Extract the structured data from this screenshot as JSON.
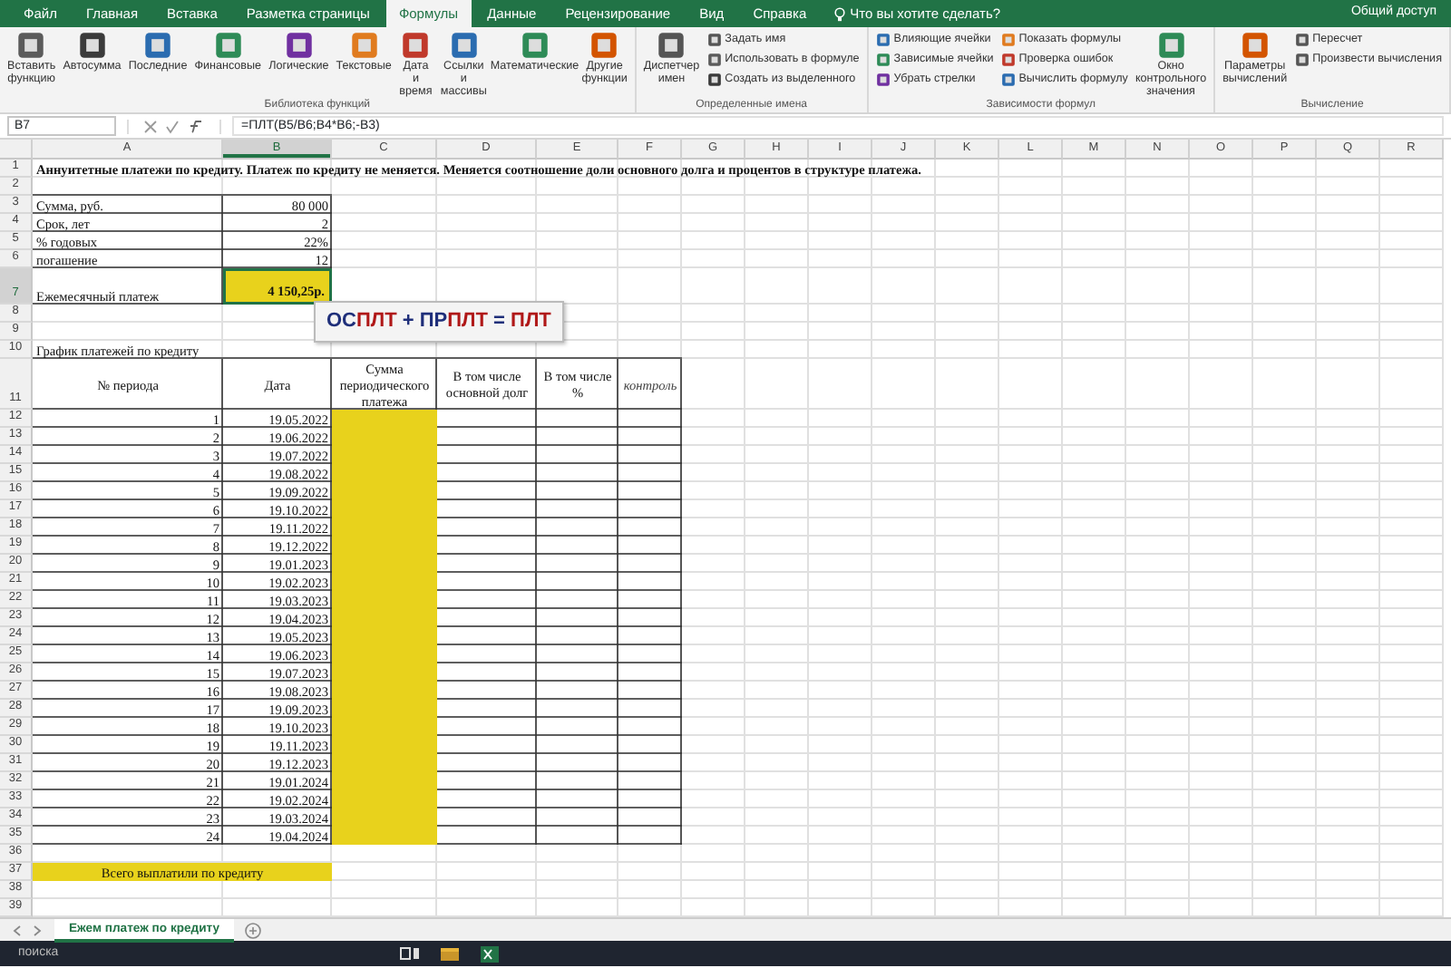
{
  "ribbon_tabs": [
    {
      "label": "Файл",
      "selected": false
    },
    {
      "label": "Главная",
      "selected": false
    },
    {
      "label": "Вставка",
      "selected": false
    },
    {
      "label": "Разметка страницы",
      "selected": false
    },
    {
      "label": "Формулы",
      "selected": true
    },
    {
      "label": "Данные",
      "selected": false
    },
    {
      "label": "Рецензирование",
      "selected": false
    },
    {
      "label": "Вид",
      "selected": false
    },
    {
      "label": "Справка",
      "selected": false
    }
  ],
  "tell_me": "Что вы хотите сделать?",
  "share": "Общий доступ",
  "ribbon_groups": [
    {
      "label": "Библиотека функций",
      "buttons": [
        {
          "label": "Вставить функцию",
          "kind": "large"
        },
        {
          "label": "Автосумма",
          "kind": "large"
        },
        {
          "label": "Последние",
          "kind": "large"
        },
        {
          "label": "Финансовые",
          "kind": "large"
        },
        {
          "label": "Логические",
          "kind": "large"
        },
        {
          "label": "Текстовые",
          "kind": "large"
        },
        {
          "label": "Дата и время",
          "kind": "large"
        },
        {
          "label": "Ссылки и массивы",
          "kind": "large"
        },
        {
          "label": "Математические",
          "kind": "large"
        },
        {
          "label": "Другие функции",
          "kind": "large"
        }
      ]
    },
    {
      "label": "Определенные имена",
      "buttons": [
        {
          "label": "Диспетчер имен",
          "kind": "large"
        },
        {
          "label": "Задать имя",
          "kind": "small"
        },
        {
          "label": "Использовать в формуле",
          "kind": "small"
        },
        {
          "label": "Создать из выделенного",
          "kind": "small"
        }
      ]
    },
    {
      "label": "Зависимости формул",
      "buttons": [
        {
          "label": "Влияющие ячейки",
          "kind": "small"
        },
        {
          "label": "Зависимые ячейки",
          "kind": "small"
        },
        {
          "label": "Убрать стрелки",
          "kind": "small"
        },
        {
          "label": "Показать формулы",
          "kind": "small"
        },
        {
          "label": "Проверка ошибок",
          "kind": "small"
        },
        {
          "label": "Вычислить формулу",
          "kind": "small"
        },
        {
          "label": "Окно контрольного значения",
          "kind": "large"
        }
      ]
    },
    {
      "label": "Вычисление",
      "buttons": [
        {
          "label": "Параметры вычислений",
          "kind": "large"
        },
        {
          "label": "Пересчет",
          "kind": "small"
        },
        {
          "label": "Произвести вычисления",
          "kind": "small"
        }
      ]
    }
  ],
  "name_box": "B7",
  "formula": "=ПЛТ(B5/B6;B4*B6;-B3)",
  "columns": [
    {
      "label": "A",
      "selected": false
    },
    {
      "label": "B",
      "selected": true
    },
    {
      "label": "C",
      "selected": false
    },
    {
      "label": "D",
      "selected": false
    },
    {
      "label": "E",
      "selected": false
    },
    {
      "label": "F",
      "selected": false
    },
    {
      "label": "G",
      "selected": false
    },
    {
      "label": "H",
      "selected": false
    },
    {
      "label": "I",
      "selected": false
    },
    {
      "label": "J",
      "selected": false
    },
    {
      "label": "K",
      "selected": false
    },
    {
      "label": "L",
      "selected": false
    },
    {
      "label": "M",
      "selected": false
    },
    {
      "label": "N",
      "selected": false
    },
    {
      "label": "O",
      "selected": false
    },
    {
      "label": "P",
      "selected": false
    },
    {
      "label": "Q",
      "selected": false
    },
    {
      "label": "R",
      "selected": false
    }
  ],
  "row_numbers": [
    {
      "label": "1",
      "selected": false
    },
    {
      "label": "2",
      "selected": false
    },
    {
      "label": "3",
      "selected": false
    },
    {
      "label": "4",
      "selected": false
    },
    {
      "label": "5",
      "selected": false
    },
    {
      "label": "6",
      "selected": false
    },
    {
      "label": "7",
      "selected": true
    },
    {
      "label": "8",
      "selected": false
    },
    {
      "label": "9",
      "selected": false
    },
    {
      "label": "10",
      "selected": false
    },
    {
      "label": "11",
      "selected": false
    },
    {
      "label": "12",
      "selected": false
    },
    {
      "label": "13",
      "selected": false
    },
    {
      "label": "14",
      "selected": false
    },
    {
      "label": "15",
      "selected": false
    },
    {
      "label": "16",
      "selected": false
    },
    {
      "label": "17",
      "selected": false
    },
    {
      "label": "18",
      "selected": false
    },
    {
      "label": "19",
      "selected": false
    },
    {
      "label": "20",
      "selected": false
    },
    {
      "label": "21",
      "selected": false
    },
    {
      "label": "22",
      "selected": false
    },
    {
      "label": "23",
      "selected": false
    },
    {
      "label": "24",
      "selected": false
    },
    {
      "label": "25",
      "selected": false
    },
    {
      "label": "26",
      "selected": false
    },
    {
      "label": "27",
      "selected": false
    },
    {
      "label": "28",
      "selected": false
    },
    {
      "label": "29",
      "selected": false
    },
    {
      "label": "30",
      "selected": false
    },
    {
      "label": "31",
      "selected": false
    },
    {
      "label": "32",
      "selected": false
    },
    {
      "label": "33",
      "selected": false
    },
    {
      "label": "34",
      "selected": false
    },
    {
      "label": "35",
      "selected": false
    },
    {
      "label": "36",
      "selected": false
    },
    {
      "label": "37",
      "selected": false
    },
    {
      "label": "38",
      "selected": false
    },
    {
      "label": "39",
      "selected": false
    }
  ],
  "title": "Аннуитетные платежи по кредиту. Платеж по кредиту не меняется. Меняется соотношение доли основного долга и процентов в структуре платежа.",
  "params": [
    {
      "label": "Сумма, руб.",
      "value": "80 000",
      "kind": "input",
      "selected": false
    },
    {
      "label": "Срок, лет",
      "value": "2",
      "kind": "input",
      "selected": false
    },
    {
      "label": "% годовых",
      "value": "22%",
      "kind": "input",
      "selected": false
    },
    {
      "label": "погашение",
      "value": "12",
      "kind": "input",
      "selected": false
    },
    {
      "label": "Ежемесячный платеж",
      "value": "4 150,25р.",
      "kind": "result",
      "selected": true
    }
  ],
  "formula_shape": {
    "parts": [
      {
        "text": "ОС",
        "color": "#1f2f7a"
      },
      {
        "text": "ПЛТ",
        "color": "#b01818"
      },
      {
        "text": " + ",
        "color": "#1f2f7a"
      },
      {
        "text": "ПР",
        "color": "#1f2f7a"
      },
      {
        "text": "ПЛТ",
        "color": "#b01818"
      },
      {
        "text": " = ",
        "color": "#1f2f7a"
      },
      {
        "text": "ПЛТ",
        "color": "#b01818"
      }
    ]
  },
  "schedule_title": "График платежей по кредиту",
  "schedule": {
    "headers": [
      {
        "label": "№ периода",
        "kind": "plain"
      },
      {
        "label": "Дата",
        "kind": "plain"
      },
      {
        "label": "Сумма периодического платежа",
        "kind": "plain"
      },
      {
        "label": "В том числе основной долг",
        "kind": "plain"
      },
      {
        "label": "В том числе %",
        "kind": "plain"
      },
      {
        "label": "контроль",
        "kind": "note"
      }
    ],
    "rows": [
      {
        "period": "1",
        "date": "19.05.2022"
      },
      {
        "period": "2",
        "date": "19.06.2022"
      },
      {
        "period": "3",
        "date": "19.07.2022"
      },
      {
        "period": "4",
        "date": "19.08.2022"
      },
      {
        "period": "5",
        "date": "19.09.2022"
      },
      {
        "period": "6",
        "date": "19.10.2022"
      },
      {
        "period": "7",
        "date": "19.11.2022"
      },
      {
        "period": "8",
        "date": "19.12.2022"
      },
      {
        "period": "9",
        "date": "19.01.2023"
      },
      {
        "period": "10",
        "date": "19.02.2023"
      },
      {
        "period": "11",
        "date": "19.03.2023"
      },
      {
        "period": "12",
        "date": "19.04.2023"
      },
      {
        "period": "13",
        "date": "19.05.2023"
      },
      {
        "period": "14",
        "date": "19.06.2023"
      },
      {
        "period": "15",
        "date": "19.07.2023"
      },
      {
        "period": "16",
        "date": "19.08.2023"
      },
      {
        "period": "17",
        "date": "19.09.2023"
      },
      {
        "period": "18",
        "date": "19.10.2023"
      },
      {
        "period": "19",
        "date": "19.11.2023"
      },
      {
        "period": "20",
        "date": "19.12.2023"
      },
      {
        "period": "21",
        "date": "19.01.2024"
      },
      {
        "period": "22",
        "date": "19.02.2024"
      },
      {
        "period": "23",
        "date": "19.03.2024"
      },
      {
        "period": "24",
        "date": "19.04.2024"
      }
    ]
  },
  "total_label": "Всего выплатили по кредиту",
  "sheet_tabs": [
    {
      "label": "Ежем платеж по кредиту",
      "selected": true
    }
  ],
  "taskbar": {
    "search": "поиска"
  }
}
